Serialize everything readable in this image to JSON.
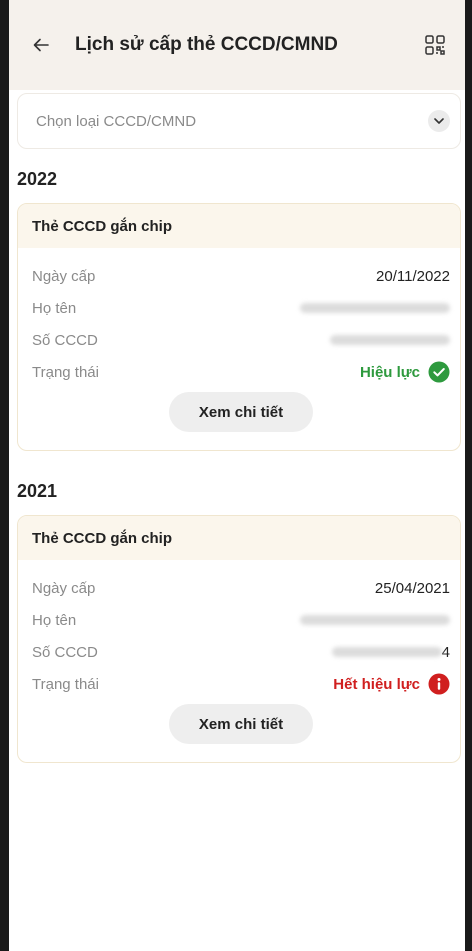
{
  "header": {
    "title": "Lịch sử cấp thẻ CCCD/CMND",
    "back_icon": "arrow-left-icon",
    "qr_icon": "qr-code-icon"
  },
  "filter": {
    "placeholder": "Chọn loại CCCD/CMND",
    "icon": "chevron-down-icon"
  },
  "groups": [
    {
      "year": "2022",
      "card": {
        "title": "Thẻ CCCD gắn chip",
        "rows": [
          {
            "label": "Ngày cấp",
            "value": "20/11/2022"
          },
          {
            "label": "Họ tên",
            "value": ""
          },
          {
            "label": "Số CCCD",
            "value": ""
          }
        ],
        "status_label": "Trạng thái",
        "status_value": "Hiệu lực",
        "status_color": "#2e9a3e",
        "status_icon": "check-circle-icon",
        "button_label": "Xem chi tiết"
      }
    },
    {
      "year": "2021",
      "card": {
        "title": "Thẻ CCCD gắn chip",
        "rows": [
          {
            "label": "Ngày cấp",
            "value": "25/04/2021"
          },
          {
            "label": "Họ tên",
            "value": ""
          },
          {
            "label": "Số CCCD",
            "value": "4"
          }
        ],
        "status_label": "Trạng thái",
        "status_value": "Hết hiệu lực",
        "status_color": "#d01f1f",
        "status_icon": "info-circle-icon",
        "button_label": "Xem chi tiết"
      }
    }
  ],
  "colors": {
    "header_bg": "#f5f1ec",
    "card_header_bg": "#fbf6ec",
    "valid": "#2e9a3e",
    "expired": "#d01f1f"
  }
}
